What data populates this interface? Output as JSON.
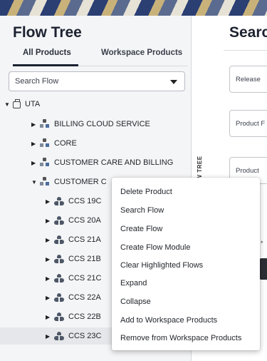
{
  "left": {
    "title": "Flow Tree",
    "tabs": [
      {
        "label": "All Products",
        "active": true
      },
      {
        "label": "Workspace Products",
        "active": false
      }
    ],
    "search_select": {
      "value": "Search Flow"
    },
    "tree": {
      "root": {
        "label": "UTA",
        "expanded": true
      },
      "products": [
        {
          "label": "BILLING CLOUD SERVICE",
          "expanded": false
        },
        {
          "label": "CORE",
          "expanded": false
        },
        {
          "label": "CUSTOMER CARE AND BILLING",
          "expanded": false
        },
        {
          "label": "CUSTOMER C",
          "expanded": true
        }
      ],
      "modules": [
        {
          "label": "CCS 19C"
        },
        {
          "label": "CCS 20A"
        },
        {
          "label": "CCS 21A"
        },
        {
          "label": "CCS 21B"
        },
        {
          "label": "CCS 21C"
        },
        {
          "label": "CCS 22A"
        },
        {
          "label": "CCS 22B"
        },
        {
          "label": "CCS 23C",
          "highlighted": true
        }
      ]
    }
  },
  "vertical_tab": {
    "label": "FLOW TREE"
  },
  "right": {
    "title": "Searc",
    "fields": [
      {
        "label": "Release"
      },
      {
        "label": "Product F"
      },
      {
        "label": "Product"
      }
    ],
    "stub_text": "*"
  },
  "context_menu": {
    "items": [
      "Delete Product",
      "Search Flow",
      "Create Flow",
      "Create Flow Module",
      "Clear Highlighted Flows",
      "Expand",
      "Collapse",
      "Add to Workspace Products",
      "Remove from Workspace Products"
    ]
  },
  "icons": {
    "root": "root-folder-icon",
    "product": "product-hierarchy-icon",
    "module": "module-group-icon",
    "dropdown": "chevron-down-icon"
  },
  "colors": {
    "panel_bg": "#f4f5f7",
    "title_text": "#1c2230",
    "highlight_row": "#e6e7ea"
  }
}
